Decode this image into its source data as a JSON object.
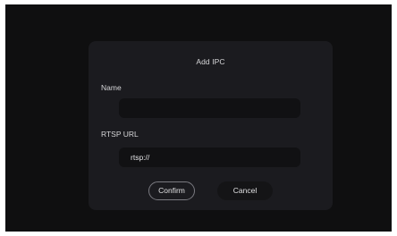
{
  "dialog": {
    "title": "Add IPC",
    "name_label": "Name",
    "name_value": "",
    "url_label": "RTSP URL",
    "url_value": "rtsp://",
    "confirm_label": "Confirm",
    "cancel_label": "Cancel"
  }
}
